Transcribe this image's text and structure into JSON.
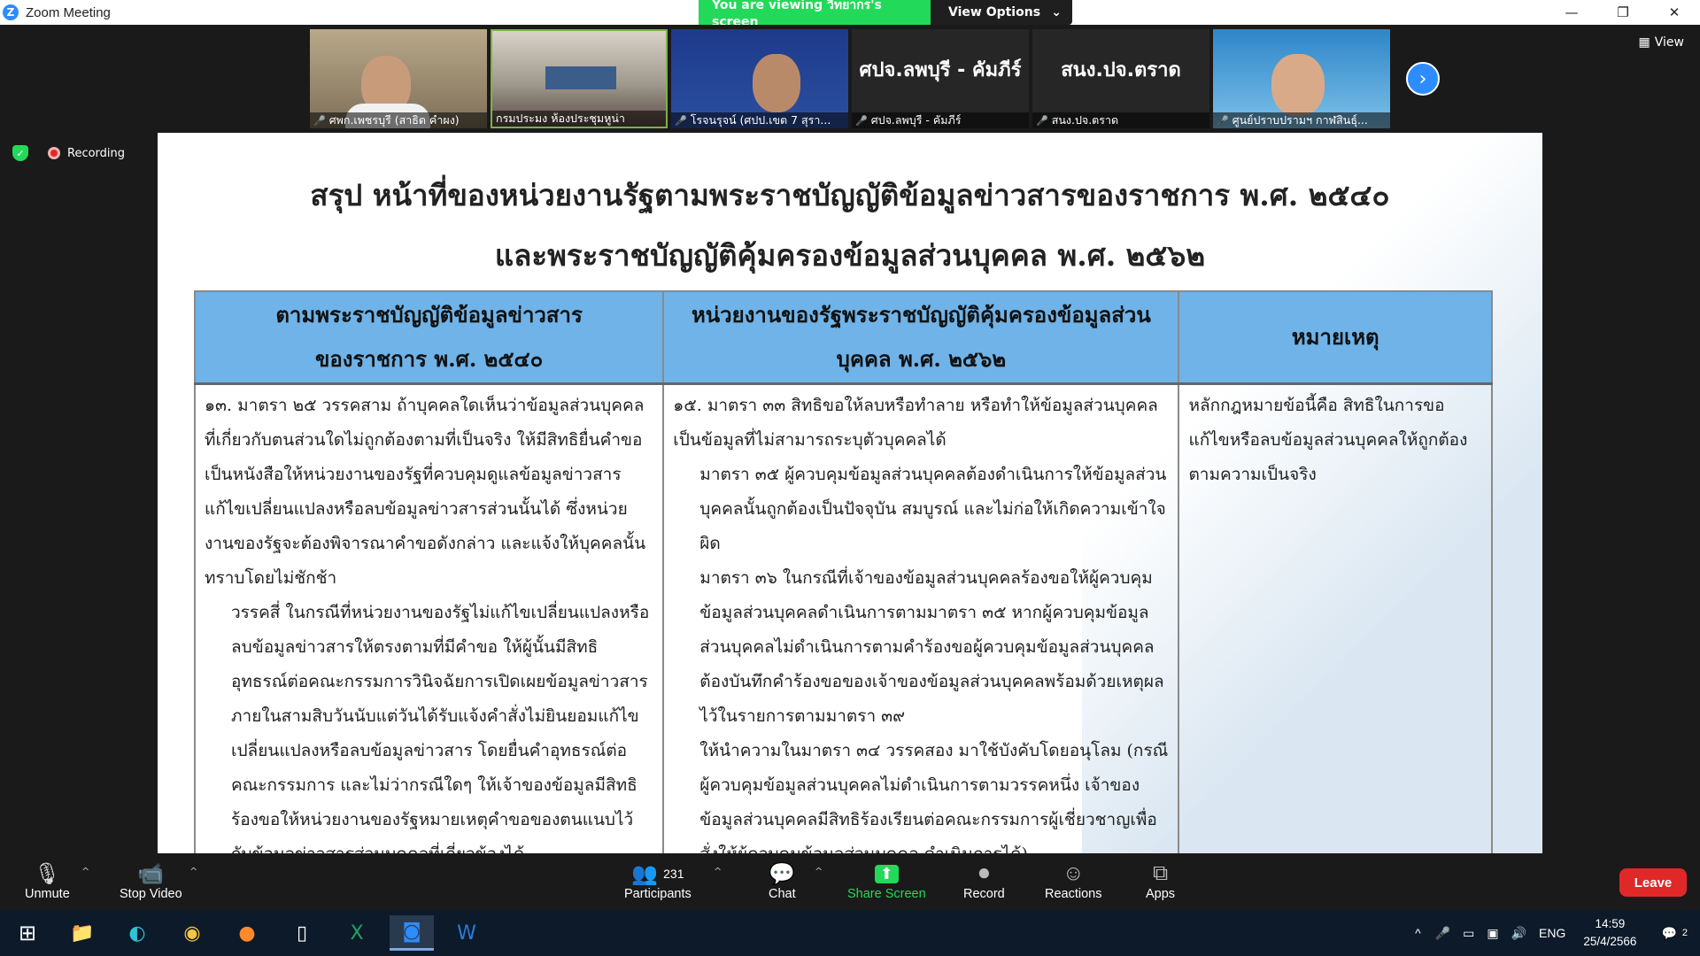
{
  "window": {
    "app_name": "Zoom Meeting"
  },
  "share_banner": {
    "text": "You are viewing วิทยากร's screen",
    "view_options": "View Options"
  },
  "participants_strip": [
    {
      "name": "ศพก.เพชรบุรี (สาธิต คำผง)",
      "kind": "video"
    },
    {
      "name": "กรมประมง ห้องประชุมหูน่า",
      "kind": "video"
    },
    {
      "name": "โรจนรุจน์ (ศปป.เขต 7 สุรา...",
      "kind": "video"
    },
    {
      "name": "ศปจ.ลพบุรี - คัมภีร์",
      "kind": "name",
      "display": "ศปจ.ลพบุรี - คัมภีร์"
    },
    {
      "name": "สนง.ปจ.ตราด",
      "kind": "name",
      "display": "สนง.ปจ.ตราด"
    },
    {
      "name": "ศูนย์ปราบปรามฯ กาฬสินธุ์...",
      "kind": "video"
    }
  ],
  "strip_view_label": "View",
  "recording_label": "Recording",
  "slide": {
    "title_line1": "สรุป หน้าที่ของหน่วยงานรัฐตามพระราชบัญญัติข้อมูลข่าวสารของราชการ พ.ศ. ๒๕๔๐",
    "title_line2": "และพระราชบัญญัติคุ้มครองข้อมูลส่วนบุคคล พ.ศ. ๒๕๖๒",
    "headers": [
      [
        "ตามพระราชบัญญัติข้อมูลข่าวสาร",
        "ของราชการ พ.ศ. ๒๕๔๐"
      ],
      [
        "หน่วยงานของรัฐพระราชบัญญัติคุ้มครองข้อมูลส่วน",
        "บุคคล พ.ศ. ๒๕๖๒"
      ],
      [
        "หมายเหตุ"
      ]
    ],
    "col1": [
      "๑๓. มาตรา ๒๕  วรรคสาม ถ้าบุคคลใดเห็นว่าข้อมูลส่วนบุคคลที่เกี่ยวกับตนส่วนใดไม่ถูกต้องตามที่เป็นจริง ให้มีสิทธิยื่นคำขอเป็นหนังสือให้หน่วยงานของรัฐที่ควบคุมดูแลข้อมูลข่าวสารแก้ไขเปลี่ยนแปลงหรือลบข้อมูลข่าวสารส่วนนั้นได้ ซึ่งหน่วยงานของรัฐจะต้องพิจารณาคำขอดังกล่าว และแจ้งให้บุคคลนั้นทราบโดยไม่ชักช้า",
      "วรรคสี่ ในกรณีที่หน่วยงานของรัฐไม่แก้ไขเปลี่ยนแปลงหรือลบข้อมูลข่าวสารให้ตรงตามที่มีคำขอ ให้ผู้นั้นมีสิทธิอุทธรณ์ต่อคณะกรรมการวินิจฉัยการเปิดเผยข้อมูลข่าวสารภายในสามสิบวันนับแต่วันได้รับแจ้งคำสั่งไม่ยินยอมแก้ไขเปลี่ยนแปลงหรือลบข้อมูลข่าวสาร  โดยยื่นคำอุทธรณ์ต่อคณะกรรมการ และไม่ว่ากรณีใดๆ ให้เจ้าของข้อมูลมีสิทธิร้องขอให้หน่วยงานของรัฐหมายเหตุคำขอของตนแนบไว้กับข้อมูลข่าวสารส่วนบุคคลที่เกี่ยวข้องได้"
    ],
    "col2": [
      "๑๕. มาตรา ๓๓ สิทธิขอให้ลบหรือทำลาย หรือทำให้ข้อมูลส่วนบุคคลเป็นข้อมูลที่ไม่สามารถระบุตัวบุคคลได้",
      "มาตรา ๓๕ ผู้ควบคุมข้อมูลส่วนบุคคลต้องดำเนินการให้ข้อมูลส่วนบุคคลนั้นถูกต้องเป็นปัจจุบัน สมบูรณ์ และไม่ก่อให้เกิดความเข้าใจผิด",
      "มาตรา ๓๖ ในกรณีที่เจ้าของข้อมูลส่วนบุคคลร้องขอให้ผู้ควบคุมข้อมูลส่วนบุคคลดำเนินการตามมาตรา ๓๕ หากผู้ควบคุมข้อมูลส่วนบุคคลไม่ดำเนินการตามคำร้องขอผู้ควบคุมข้อมูลส่วนบุคคลต้องบันทึกคำร้องขอของเจ้าของข้อมูลส่วนบุคคลพร้อมด้วยเหตุผลไว้ในรายการตามมาตรา ๓๙",
      "ให้นำความในมาตรา ๓๔ วรรคสอง มาใช้บังคับโดยอนุโลม (กรณีผู้ควบคุมข้อมูลส่วนบุคคลไม่ดำเนินการตามวรรคหนึ่ง เจ้าของข้อมูลส่วนบุคคลมีสิทธิร้องเรียนต่อคณะกรรมการผู้เชี่ยวชาญเพื่อสั่งให้ผู้ควบคุมข้อมูลส่วนบุคคล ดำเนินการได้)"
    ],
    "col3": [
      "หลักกฎหมายข้อนี้คือ สิทธิในการขอแก้ไขหรือลบข้อมูลส่วนบุคคลให้ถูกต้องตามความเป็นจริง"
    ]
  },
  "controls": {
    "unmute": "Unmute",
    "stop_video": "Stop Video",
    "participants": "Participants",
    "participant_count": "231",
    "chat": "Chat",
    "share_screen": "Share Screen",
    "record": "Record",
    "reactions": "Reactions",
    "apps": "Apps",
    "leave": "Leave"
  },
  "taskbar": {
    "language": "ENG",
    "time": "14:59",
    "date": "25/4/2566",
    "notification_count": "2"
  },
  "colors": {
    "zoom_blue": "#2d8cff",
    "share_green": "#23d959",
    "leave_red": "#e02828",
    "table_header": "#6fb3e8"
  }
}
